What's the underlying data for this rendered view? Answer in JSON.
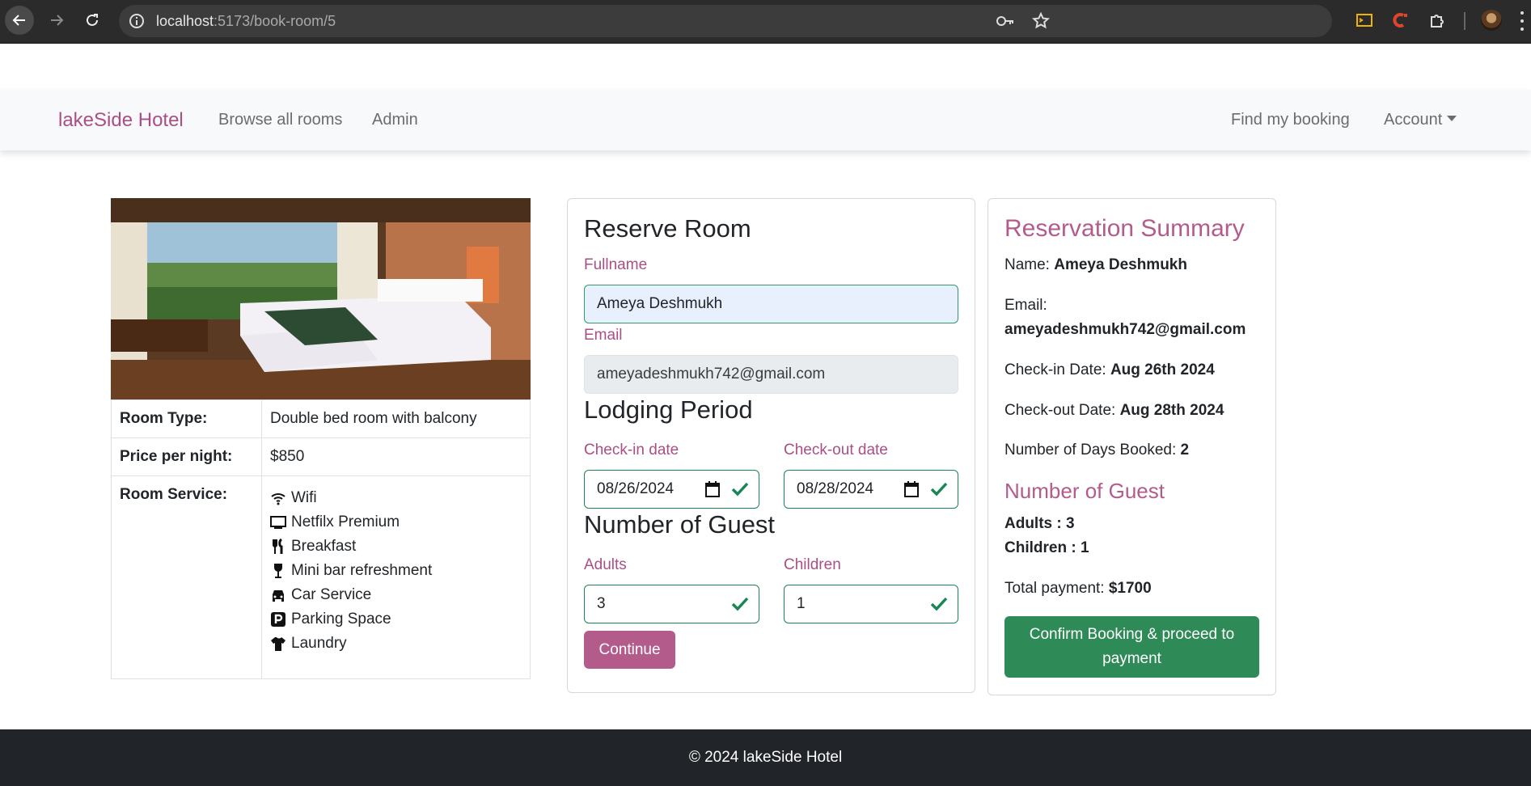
{
  "browser": {
    "url_host": "localhost",
    "url_path": ":5173/book-room/5"
  },
  "navbar": {
    "brand": "lakeSide Hotel",
    "links": [
      "Browse all rooms",
      "Admin"
    ],
    "right_links": [
      "Find my booking",
      "Account"
    ]
  },
  "room": {
    "rows": [
      {
        "label": "Room Type:",
        "value": "Double bed room with balcony"
      },
      {
        "label": "Price per night:",
        "value": "$850"
      },
      {
        "label": "Room Service:"
      }
    ],
    "services": [
      {
        "icon": "wifi-icon",
        "label": "Wifi"
      },
      {
        "icon": "tv-icon",
        "label": "Netfilx Premium"
      },
      {
        "icon": "utensils-icon",
        "label": "Breakfast"
      },
      {
        "icon": "wine-glass-icon",
        "label": "Mini bar refreshment"
      },
      {
        "icon": "car-icon",
        "label": "Car Service"
      },
      {
        "icon": "parking-icon",
        "label": "Parking Space"
      },
      {
        "icon": "tshirt-icon",
        "label": "Laundry"
      }
    ]
  },
  "reserve": {
    "title": "Reserve Room",
    "fullname_label": "Fullname",
    "fullname_value": "Ameya Deshmukh",
    "email_label": "Email",
    "email_value": "ameyadeshmukh742@gmail.com",
    "lodging_title": "Lodging Period",
    "checkin_label": "Check-in date",
    "checkin_value": "08/26/2024",
    "checkout_label": "Check-out date",
    "checkout_value": "08/28/2024",
    "guest_title": "Number of Guest",
    "adults_label": "Adults",
    "adults_value": "3",
    "children_label": "Children",
    "children_value": "1",
    "continue_label": "Continue"
  },
  "summary": {
    "title": "Reservation Summary",
    "name_label": "Name:",
    "name_value": "Ameya Deshmukh",
    "email_label": "Email:",
    "email_value": "ameyadeshmukh742@gmail.com",
    "checkin_label": "Check-in Date:",
    "checkin_value": "Aug 26th 2024",
    "checkout_label": "Check-out Date:",
    "checkout_value": "Aug 28th 2024",
    "days_label": "Number of Days Booked:",
    "days_value": "2",
    "guest_title": "Number of Guest",
    "adults_text": "Adults : 3",
    "children_text": "Children : 1",
    "total_label": "Total payment:",
    "total_value": "$1700",
    "confirm_label": "Confirm Booking & proceed to payment"
  },
  "footer": {
    "text": "© 2024 lakeSide Hotel"
  },
  "colors": {
    "brand": "#aa4f86",
    "success": "#198754",
    "confirm": "#2e8b57",
    "footer_bg": "#212529"
  }
}
